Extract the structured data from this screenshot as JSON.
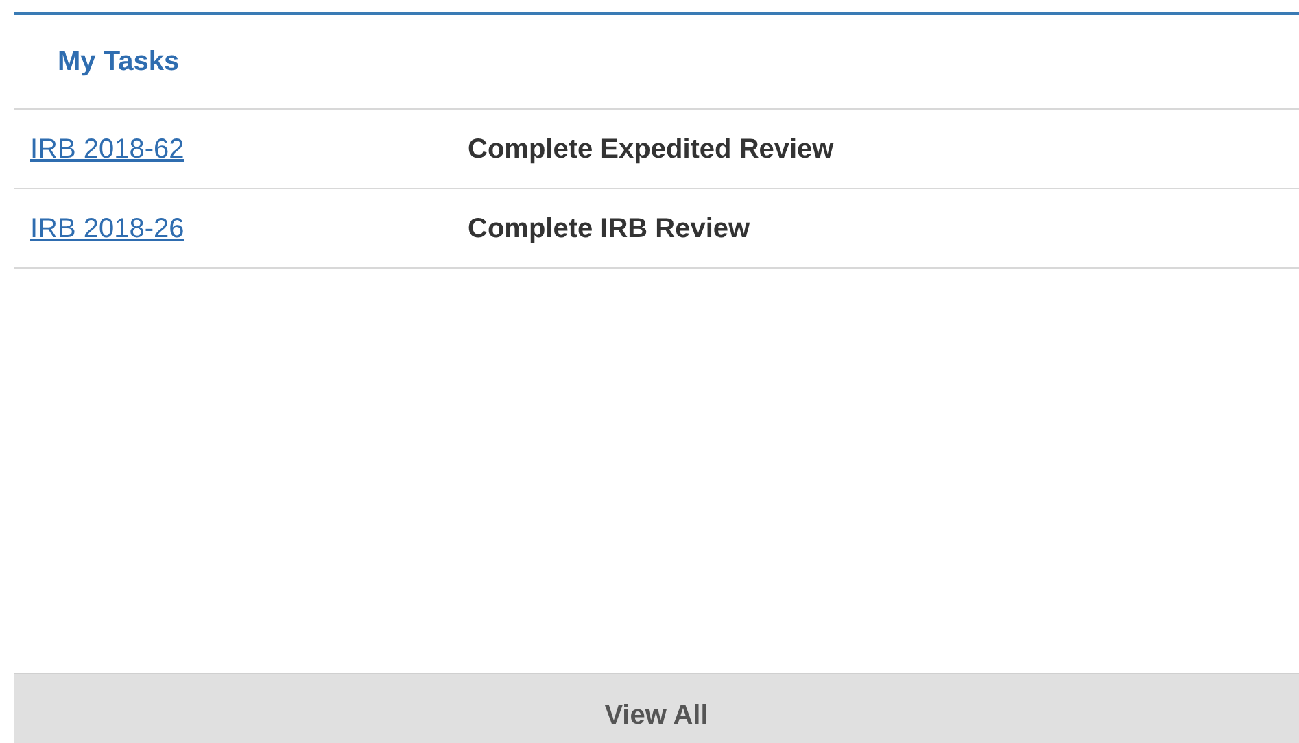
{
  "panel": {
    "title": "My Tasks"
  },
  "tasks": [
    {
      "id": "IRB 2018-62",
      "task": "Complete Expedited Review"
    },
    {
      "id": "IRB 2018-26",
      "task": "Complete IRB Review"
    }
  ],
  "footer_button": "View All"
}
